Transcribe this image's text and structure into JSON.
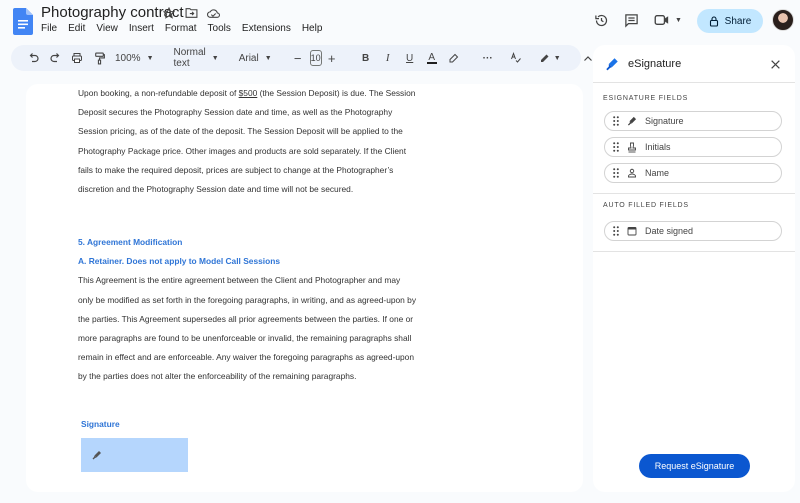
{
  "app": {
    "title": "Photography contract",
    "menu": [
      "File",
      "Edit",
      "View",
      "Insert",
      "Format",
      "Tools",
      "Extensions",
      "Help"
    ],
    "share_label": "Share"
  },
  "toolbar": {
    "zoom": "100%",
    "style": "Normal text",
    "font": "Arial",
    "font_size": "10",
    "decrease": "−",
    "increase": "+",
    "bold": "B",
    "italic": "I",
    "underline": "U",
    "text_color": "A",
    "more": "···"
  },
  "document": {
    "paragraph1": [
      {
        "pre": "Upon booking, a non-refundable deposit of ",
        "u": "$500",
        "post": " (the Session Deposit) is due. The Session"
      },
      "Deposit secures the Photography Session date and time, as well as the Photography",
      "Session pricing, as of the date of the deposit. The Session Deposit will be applied to the",
      "Photography Package price. Other images and products are sold separately. If the Client",
      "fails to make the required deposit, prices are subject to change at the Photographer’s",
      "discretion and the Photography Session date and time will not be secured."
    ],
    "heading1": "5. Agreement Modification",
    "heading2": "A. Retainer.  Does not apply to Model Call Sessions",
    "paragraph2": [
      "This Agreement is the entire agreement between the Client and Photographer and may",
      "only be modified as set forth in the foregoing paragraphs, in writing, and as agreed-upon by",
      "the parties.  This Agreement supersedes all prior agreements between the parties. If one or",
      "more paragraphs are found to be unenforceable or invalid, the remaining paragraphs shall",
      "remain in effect and are enforceable. Any waiver the foregoing paragraphs as agreed-upon",
      "by the parties does not alter the enforceability of the remaining paragraphs."
    ],
    "signature_label": "Signature"
  },
  "side_panel": {
    "title": "eSignature",
    "section1": "ESIGNATURE FIELDS",
    "fields": [
      "Signature",
      "Initials",
      "Name"
    ],
    "section2": "AUTO FILLED FIELDS",
    "auto_fields": [
      "Date signed"
    ],
    "request_label": "Request eSignature"
  },
  "colors": {
    "accent": "#0b57d0",
    "share_bg": "#c2e7ff",
    "heading": "#2f75d6",
    "signature_box": "#b5d6fd"
  }
}
